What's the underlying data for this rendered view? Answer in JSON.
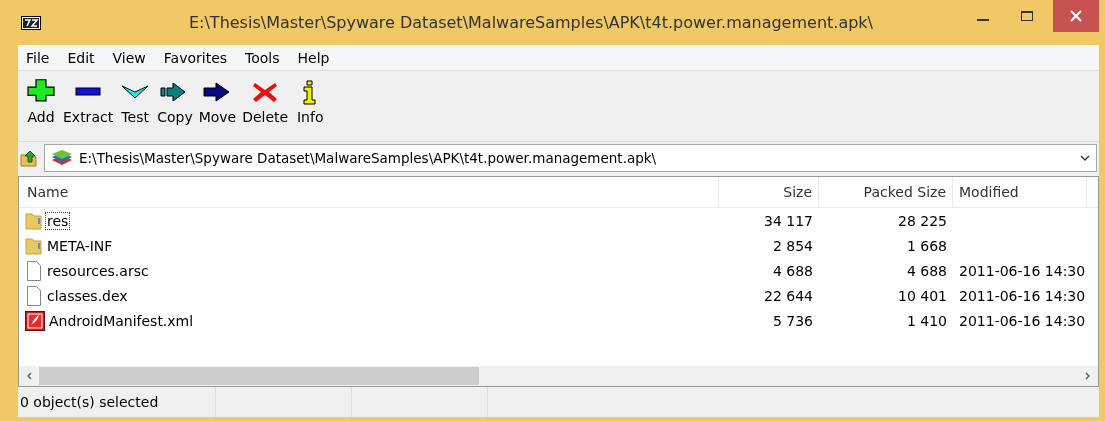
{
  "window": {
    "title": "E:\\Thesis\\Master\\Spyware Dataset\\MalwareSamples\\APK\\t4t.power.management.apk\\"
  },
  "menu": [
    "File",
    "Edit",
    "View",
    "Favorites",
    "Tools",
    "Help"
  ],
  "toolbar": [
    {
      "label": "Add",
      "kind": "add"
    },
    {
      "label": "Extract",
      "kind": "extract"
    },
    {
      "label": "Test",
      "kind": "test"
    },
    {
      "label": "Copy",
      "kind": "copy"
    },
    {
      "label": "Move",
      "kind": "move"
    },
    {
      "label": "Delete",
      "kind": "delete"
    },
    {
      "label": "Info",
      "kind": "info"
    }
  ],
  "address": {
    "value": "E:\\Thesis\\Master\\Spyware Dataset\\MalwareSamples\\APK\\t4t.power.management.apk\\"
  },
  "table": {
    "columns": [
      "Name",
      "Size",
      "Packed Size",
      "Modified"
    ],
    "rows": [
      {
        "kind": "folder",
        "name": "res",
        "size": "34 117",
        "packed": "28 225",
        "modified": "",
        "focused": true
      },
      {
        "kind": "folder",
        "name": "META-INF",
        "size": "2 854",
        "packed": "1 668",
        "modified": "",
        "focused": false
      },
      {
        "kind": "file",
        "name": "resources.arsc",
        "size": "4 688",
        "packed": "4 688",
        "modified": "2011-06-16 14:30",
        "focused": false
      },
      {
        "kind": "file",
        "name": "classes.dex",
        "size": "22 644",
        "packed": "10 401",
        "modified": "2011-06-16 14:30",
        "focused": false
      },
      {
        "kind": "xml",
        "name": "AndroidManifest.xml",
        "size": "5 736",
        "packed": "1 410",
        "modified": "2011-06-16 14:30",
        "focused": false
      }
    ]
  },
  "status_bar": {
    "text": "0 object(s) selected"
  }
}
